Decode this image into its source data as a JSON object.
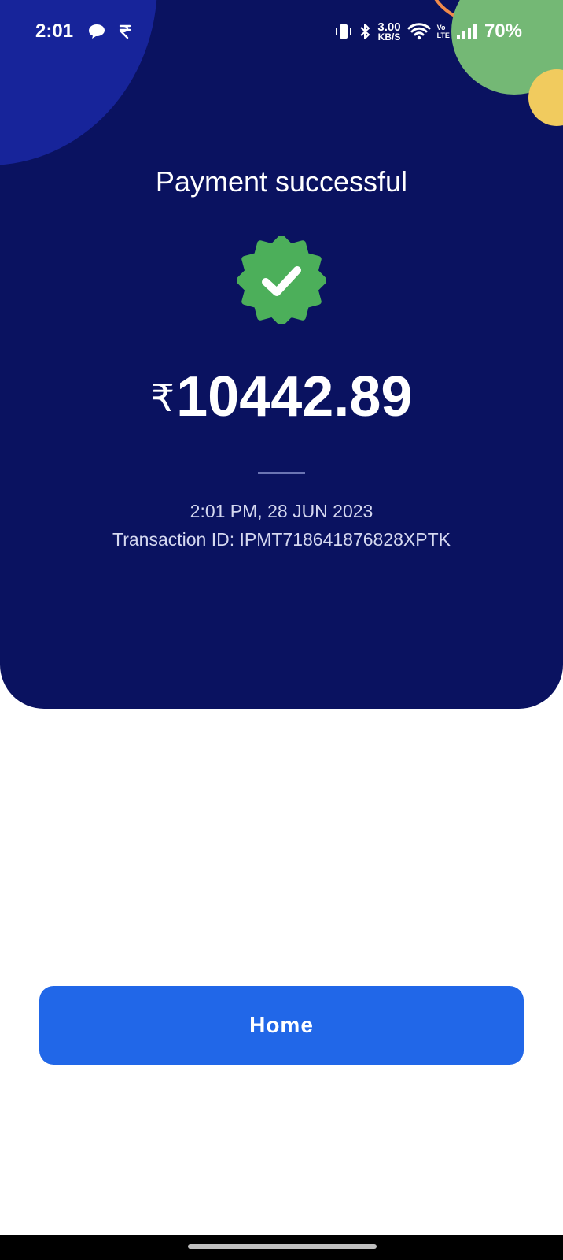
{
  "status_bar": {
    "time": "2:01",
    "speed_value": "3.00",
    "speed_unit": "KB/S",
    "volte_top": "Vo",
    "volte_bottom": "LTE",
    "battery": "70%",
    "icons": [
      "chat-bubble-icon",
      "rupee-icon",
      "vibrate-icon",
      "bluetooth-icon",
      "wifi-icon",
      "signal-icon"
    ]
  },
  "payment": {
    "title": "Payment successful",
    "currency_symbol": "₹",
    "amount": "10442.89",
    "datetime": "2:01 PM, 28 JUN 2023",
    "transaction_label": "Transaction ID: IPMT718641876828XPTK"
  },
  "actions": {
    "home_label": "Home"
  },
  "colors": {
    "hero_bg": "#0a1260",
    "success_green": "#4caf5a",
    "button_blue": "#2167e8"
  }
}
